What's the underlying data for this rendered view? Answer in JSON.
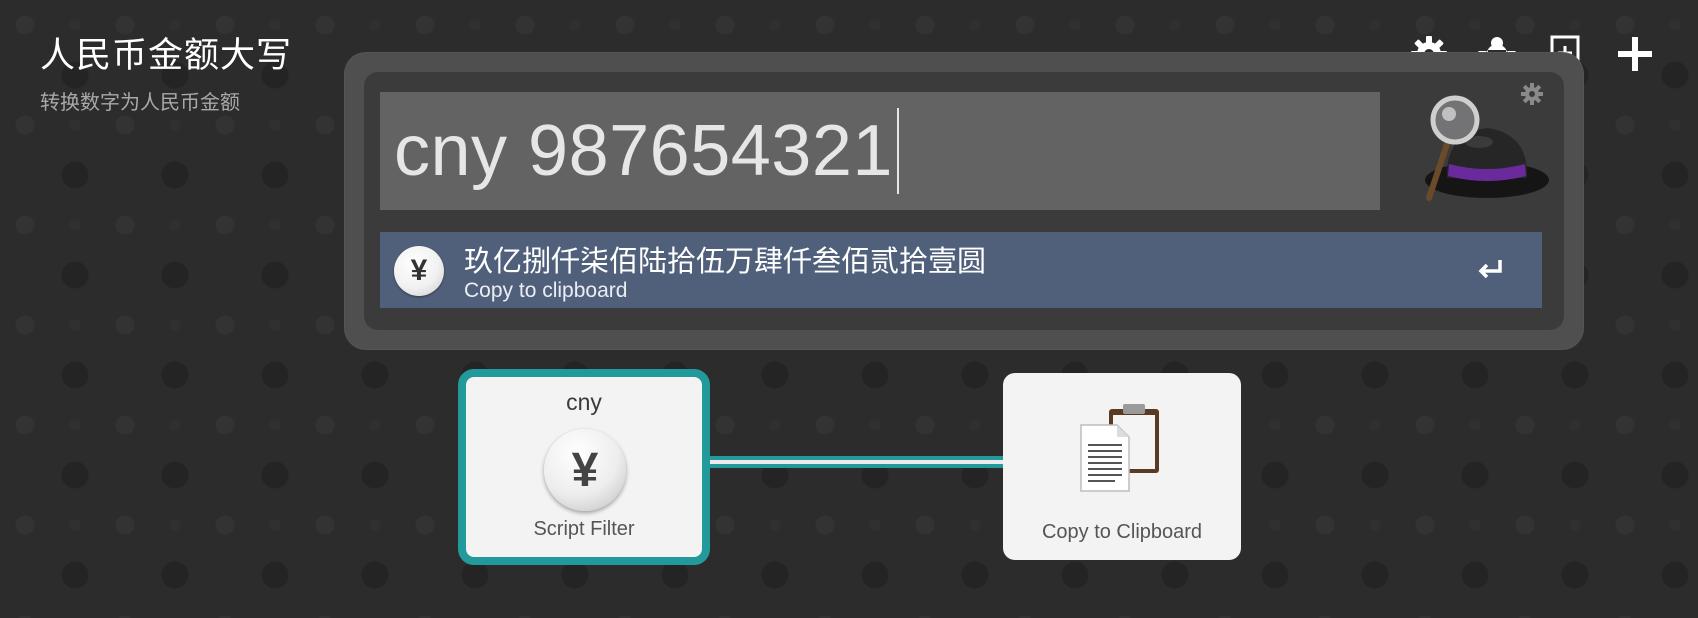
{
  "workflow": {
    "title": "人民币金额大写",
    "subtitle": "转换数字为人民币金额"
  },
  "toolbar": {
    "items": [
      {
        "icon": "gear-icon"
      },
      {
        "icon": "bug-icon"
      },
      {
        "icon": "add-note-icon"
      },
      {
        "icon": "plus-icon"
      }
    ]
  },
  "alfred": {
    "query": "cny 987654321",
    "result": {
      "icon": "yen-icon",
      "title": "玖亿捌仟柒佰陆拾伍万肆仟叁佰贰拾壹圆",
      "subtitle": "Copy to clipboard",
      "accent_color": "#50607b"
    }
  },
  "nodes": {
    "script_filter": {
      "keyword": "cny",
      "label": "Script Filter",
      "icon": "yen-icon",
      "border_color": "#22999a"
    },
    "copy_clipboard": {
      "label": "Copy to Clipboard",
      "icon": "clipboard-icon"
    }
  }
}
